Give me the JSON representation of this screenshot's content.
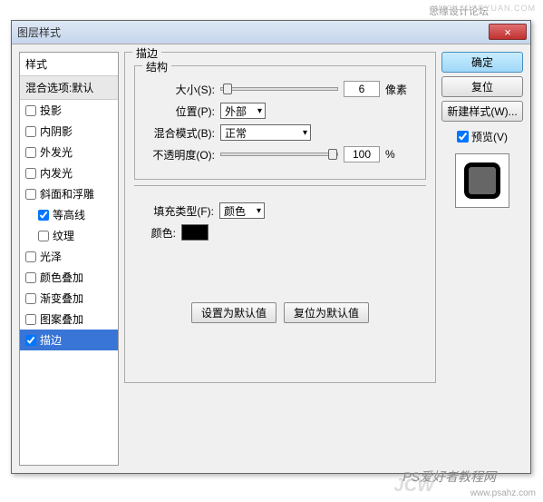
{
  "watermarks": {
    "top1": "思缘设计论坛",
    "top2": "WWW.MISSYUAN.COM",
    "bottom_jcw": "JCW",
    "bottom_ps": "PS爱好者教程网",
    "bottom_url": "www.psahz.com"
  },
  "dialog": {
    "title": "图层样式",
    "close": "×"
  },
  "styles": {
    "header": "样式",
    "blend": "混合选项:默认",
    "items": [
      {
        "label": "投影",
        "checked": false,
        "indent": false
      },
      {
        "label": "内阴影",
        "checked": false,
        "indent": false
      },
      {
        "label": "外发光",
        "checked": false,
        "indent": false
      },
      {
        "label": "内发光",
        "checked": false,
        "indent": false
      },
      {
        "label": "斜面和浮雕",
        "checked": false,
        "indent": false
      },
      {
        "label": "等高线",
        "checked": true,
        "indent": true
      },
      {
        "label": "纹理",
        "checked": false,
        "indent": true
      },
      {
        "label": "光泽",
        "checked": false,
        "indent": false
      },
      {
        "label": "颜色叠加",
        "checked": false,
        "indent": false
      },
      {
        "label": "渐变叠加",
        "checked": false,
        "indent": false
      },
      {
        "label": "图案叠加",
        "checked": false,
        "indent": false
      },
      {
        "label": "描边",
        "checked": true,
        "indent": false,
        "selected": true
      }
    ]
  },
  "stroke": {
    "panel_title": "描边",
    "structure_title": "结构",
    "size_label": "大小(S):",
    "size_value": "6",
    "size_unit": "像素",
    "position_label": "位置(P):",
    "position_value": "外部",
    "blend_label": "混合模式(B):",
    "blend_value": "正常",
    "opacity_label": "不透明度(O):",
    "opacity_value": "100",
    "opacity_unit": "%",
    "fill_label": "填充类型(F):",
    "fill_value": "颜色",
    "color_label": "颜色:",
    "set_default": "设置为默认值",
    "reset_default": "复位为默认值"
  },
  "right": {
    "ok": "确定",
    "cancel": "复位",
    "new_style": "新建样式(W)...",
    "preview_label": "预览(V)"
  }
}
